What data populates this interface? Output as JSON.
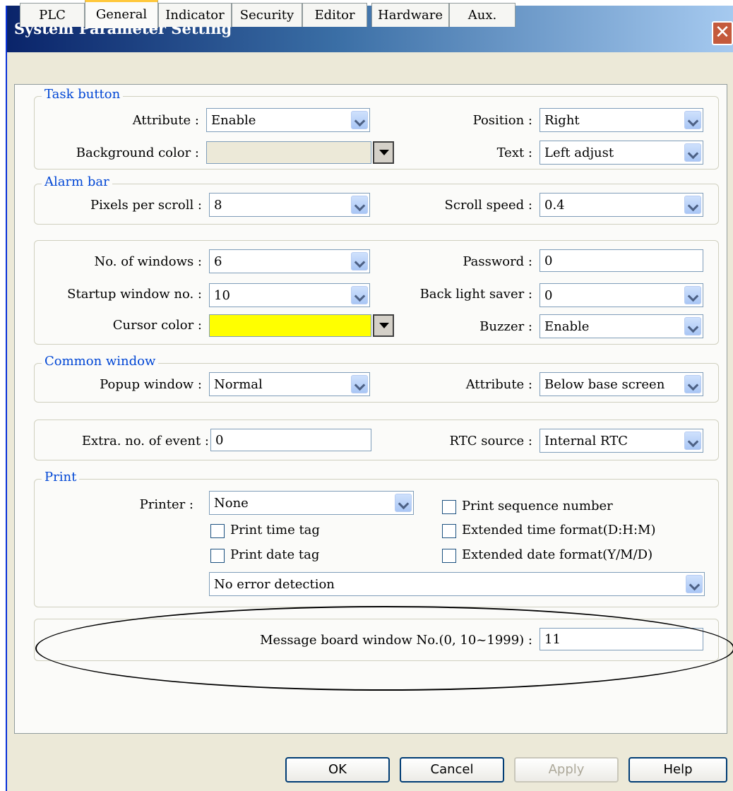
{
  "window": {
    "title": "System Parameter Setting"
  },
  "tabs": [
    "PLC",
    "General",
    "Indicator",
    "Security",
    "Editor",
    "Hardware",
    "Aux."
  ],
  "active_tab": "General",
  "task_button": {
    "legend": "Task button",
    "attribute_label": "Attribute :",
    "attribute_value": "Enable",
    "position_label": "Position :",
    "position_value": "Right",
    "bgcolor_label": "Background color :",
    "text_label": "Text :",
    "text_value": "Left adjust"
  },
  "alarm_bar": {
    "legend": "Alarm bar",
    "pixels_label": "Pixels per scroll :",
    "pixels_value": "8",
    "speed_label": "Scroll speed :",
    "speed_value": "0.4"
  },
  "general": {
    "windows_label": "No. of windows :",
    "windows_value": "6",
    "password_label": "Password :",
    "password_value": "0",
    "startup_label": "Startup window no. :",
    "startup_value": "10",
    "backlight_label": "Back light saver :",
    "backlight_value": "0",
    "cursor_label": "Cursor color :",
    "buzzer_label": "Buzzer :",
    "buzzer_value": "Enable"
  },
  "common_window": {
    "legend": "Common window",
    "popup_label": "Popup window :",
    "popup_value": "Normal",
    "attribute_label": "Attribute :",
    "attribute_value": "Below base screen"
  },
  "events": {
    "extra_label": "Extra. no. of event :",
    "extra_value": "0",
    "rtc_label": "RTC source :",
    "rtc_value": "Internal RTC"
  },
  "print": {
    "legend": "Print",
    "printer_label": "Printer :",
    "printer_value": "None",
    "seq_label": "Print sequence number",
    "time_tag_label": "Print time tag",
    "ext_time_label": "Extended time format(D:H:M)",
    "date_tag_label": "Print date tag",
    "ext_date_label": "Extended date format(Y/M/D)",
    "error_value": "No error detection"
  },
  "message_board": {
    "label": "Message board window No.(0, 10~1999) :",
    "value": "11"
  },
  "buttons": {
    "ok": "OK",
    "cancel": "Cancel",
    "apply": "Apply",
    "help": "Help"
  },
  "colors": {
    "cursor_color": "#ffff00",
    "title_bar": "#0a246a",
    "legend_text": "#0046d5"
  }
}
